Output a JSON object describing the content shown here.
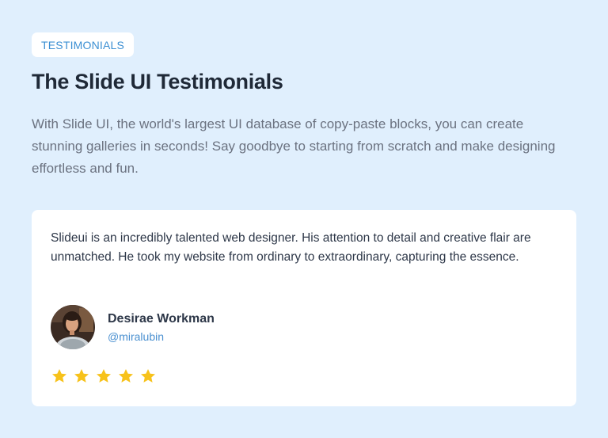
{
  "section": {
    "badge": "TESTIMONIALS",
    "title": "The Slide UI Testimonials",
    "intro": "With Slide UI, the world's largest UI database of copy-paste blocks, you can create stunning galleries in seconds! Say goodbye to starting from scratch and make designing effortless and fun."
  },
  "testimonial": {
    "quote": "Slideui is an incredibly talented web designer. His attention to detail and creative flair are unmatched. He took my website from ordinary to extraordinary, capturing the essence.",
    "author_name": "Desirae Workman",
    "author_handle": "@miralubin",
    "rating": 5,
    "rating_max": 5,
    "star_icon": "star-icon",
    "avatar_icon": "avatar-photo"
  },
  "colors": {
    "background": "#e0effd",
    "accent": "#3b8fd3",
    "star": "#f7c21b"
  }
}
